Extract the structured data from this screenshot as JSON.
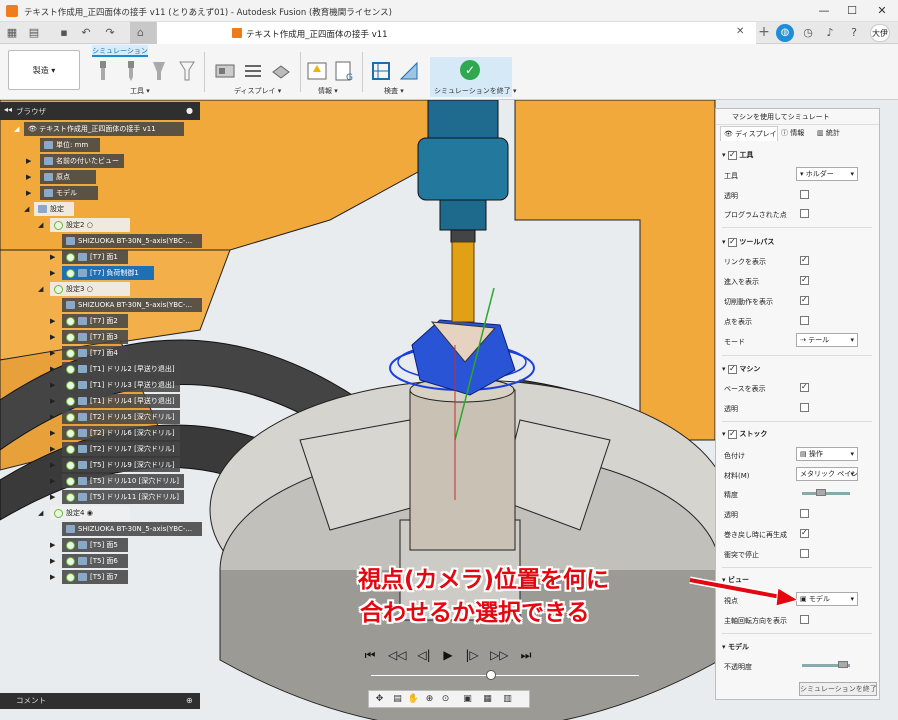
{
  "window": {
    "title": "テキスト作成用_正四面体の接手 v11 (とりあえず01) - Autodesk Fusion (教育機関ライセンス)",
    "controls": [
      "—",
      "☐",
      "✕"
    ]
  },
  "tabbar": {
    "document_title": "テキスト作成用_正四面体の接手 v11",
    "user_initials": "大伊"
  },
  "toolbar": {
    "workspace": "製造",
    "active_tab": "シミュレーション",
    "groups": [
      "工具",
      "ディスプレイ",
      "情報",
      "検査",
      "シミュレーションを終了"
    ]
  },
  "browser": {
    "title": "ブラウザ",
    "nodes": [
      "テキスト作成用_正四面体の接手 v11",
      "単位: mm",
      "名前の付いたビュー",
      "原点",
      "モデル",
      "設定",
      "設定2",
      "SHIZUOKA BT-30N_5-axis(YBC-...",
      "[T7] 面1",
      "[T7] 負荷制御1",
      "設定3",
      "SHIZUOKA BT-30N_5-axis(YBC-...",
      "[T7] 面2",
      "[T7] 面3",
      "[T7] 面4",
      "[T1] ドリル2 [早送り退出]",
      "[T1] ドリル3 [早送り退出]",
      "[T1] ドリル4 [早送り退出]",
      "[T2] ドリル5 [深穴ドリル]",
      "[T2] ドリル6 [深穴ドリル]",
      "[T2] ドリル7 [深穴ドリル]",
      "[T5] ドリル9 [深穴ドリル]",
      "[T5] ドリル10 [深穴ドリル]",
      "[T5] ドリル11 [深穴ドリル]",
      "設定4",
      "SHIZUOKA BT-30N_5-axis(YBC-...",
      "[T5] 面5",
      "[T5] 面6",
      "[T5] 面7"
    ],
    "comment_label": "コメント"
  },
  "sim_panel": {
    "title": "マシンを使用してシミュレート",
    "tabs": [
      "ディスプレイ",
      "情報",
      "統計"
    ],
    "tool_section": {
      "header": "工具",
      "tool_label": "工具",
      "tool_value": "ホルダー",
      "transparent": "透明",
      "programmed": "プログラムされた点"
    },
    "toolpath_section": {
      "header": "ツールパス",
      "links": "リンクを表示",
      "entry": "進入を表示",
      "cut": "切削動作を表示",
      "points": "点を表示",
      "mode_label": "モード",
      "mode_value": "テール"
    },
    "machine_section": {
      "header": "マシン",
      "base": "ベースを表示",
      "transparent": "透明"
    },
    "stock_section": {
      "header": "ストック",
      "color_label": "色付け",
      "color_value": "操作",
      "material_label": "材料(M)",
      "material_value": "メタリック ペイン...",
      "accuracy_label": "精度",
      "transparent": "透明",
      "regen": "巻き戻し時に再生成",
      "collision": "衝突で停止"
    },
    "view_section": {
      "header": "ビュー",
      "viewpoint_label": "視点",
      "viewpoint_value": "モデル",
      "spindle": "主軸回転方向を表示"
    },
    "model_section": {
      "header": "モデル",
      "opacity_label": "不透明度"
    },
    "stop_button": "シミュレーションを終了"
  },
  "annotation": {
    "line1": "視点(カメラ)位置を何に",
    "line2": "合わせるか選択できる"
  },
  "colors": {
    "accent": "#1a8ad6",
    "annotation": "#e4070f",
    "finish": "#2fa84f"
  }
}
